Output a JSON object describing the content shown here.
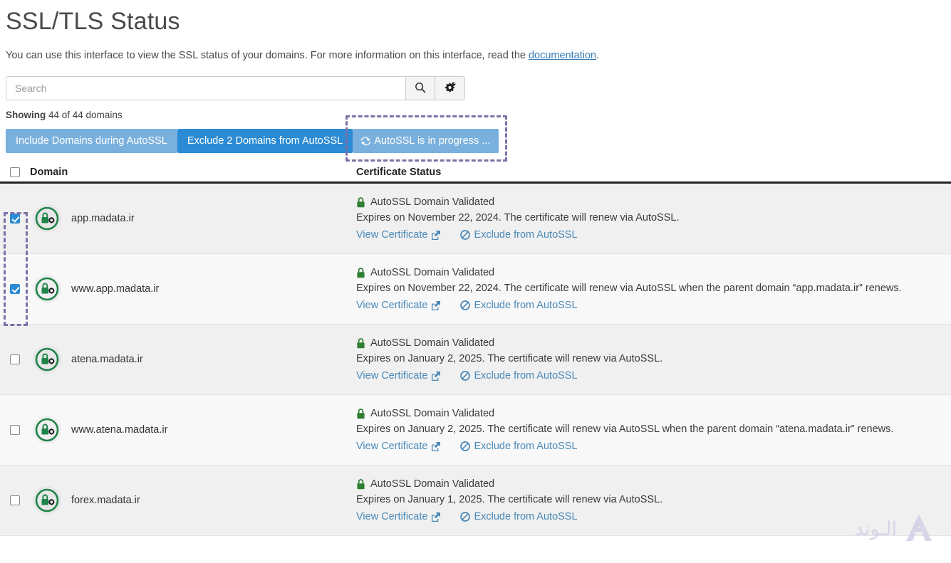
{
  "header": {
    "title": "SSL/TLS Status",
    "intro_before": "You can use this interface to view the SSL status of your domains. For more information on this interface, read the ",
    "intro_link": "documentation",
    "intro_after": "."
  },
  "search": {
    "placeholder": "Search",
    "value": "",
    "search_icon": "search-icon",
    "settings_icon": "gears-icon"
  },
  "showing": {
    "label": "Showing",
    "text": " 44 of 44 domains",
    "count": 44,
    "total": 44
  },
  "actions": {
    "include_label": "Include Domains during AutoSSL",
    "exclude_label": "Exclude 2 Domains from AutoSSL",
    "progress_label": "AutoSSL is in progress ...",
    "progress_icon": "refresh-icon",
    "highlight_color": "#7f6fa8",
    "primary_color": "#2b8bd4",
    "light_color": "#7ab0dd"
  },
  "table": {
    "headers": {
      "domain": "Domain",
      "status": "Certificate Status"
    },
    "select_all_checked": false,
    "rows": [
      {
        "domain": "app.madata.ir",
        "checked": true,
        "icon": "ssl-lock-green-icon",
        "status_title": "AutoSSL Domain Validated",
        "status_detail": "Expires on November 22, 2024. The certificate will renew via AutoSSL.",
        "view_label": "View Certificate",
        "exclude_label": "Exclude from AutoSSL"
      },
      {
        "domain": "www.app.madata.ir",
        "checked": true,
        "icon": "ssl-lock-green-icon",
        "status_title": "AutoSSL Domain Validated",
        "status_detail": "Expires on November 22, 2024. The certificate will renew via AutoSSL when the parent domain “app.madata.ir” renews.",
        "view_label": "View Certificate",
        "exclude_label": "Exclude from AutoSSL"
      },
      {
        "domain": "atena.madata.ir",
        "checked": false,
        "icon": "ssl-lock-green-icon",
        "status_title": "AutoSSL Domain Validated",
        "status_detail": "Expires on January 2, 2025. The certificate will renew via AutoSSL.",
        "view_label": "View Certificate",
        "exclude_label": "Exclude from AutoSSL"
      },
      {
        "domain": "www.atena.madata.ir",
        "checked": false,
        "icon": "ssl-lock-green-icon",
        "status_title": "AutoSSL Domain Validated",
        "status_detail": "Expires on January 2, 2025. The certificate will renew via AutoSSL when the parent domain “atena.madata.ir” renews.",
        "view_label": "View Certificate",
        "exclude_label": "Exclude from AutoSSL"
      },
      {
        "domain": "forex.madata.ir",
        "checked": false,
        "icon": "ssl-lock-green-icon",
        "status_title": "AutoSSL Domain Validated",
        "status_detail": "Expires on January 1, 2025. The certificate will renew via AutoSSL.",
        "view_label": "View Certificate",
        "exclude_label": "Exclude from AutoSSL"
      }
    ]
  },
  "watermark": {
    "text": "الـوند",
    "logo_icon": "a-logo-icon",
    "color": "#d5d2e8"
  }
}
